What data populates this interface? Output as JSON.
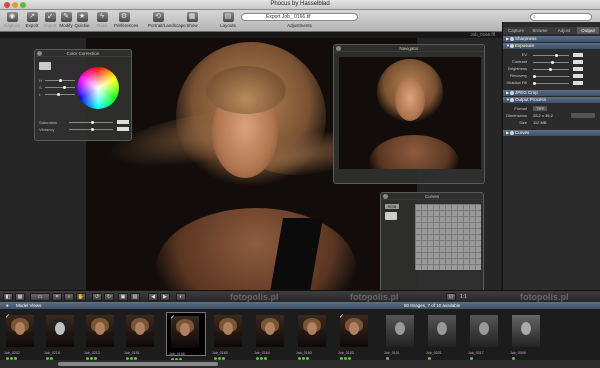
{
  "window": {
    "title": "Phocus by Hasselblad"
  },
  "toolbar": {
    "items": [
      {
        "label": "Capture",
        "enabled": false
      },
      {
        "label": "Export",
        "enabled": true
      },
      {
        "label": "Import",
        "enabled": false
      },
      {
        "label": "Modify",
        "enabled": true
      },
      {
        "label": "Quickie",
        "enabled": true
      },
      {
        "label": "Flash",
        "enabled": false
      },
      {
        "label": "Preferences",
        "enabled": true
      },
      {
        "label": "Portrait/Landscape",
        "enabled": true
      },
      {
        "label": "Show",
        "enabled": true
      },
      {
        "label": "Layouts",
        "enabled": true
      }
    ],
    "adjustments_field": "Export Job_ 0166.tif",
    "adjustments_label": "Adjustments",
    "search_label": "Search"
  },
  "viewer": {
    "status": "Job_0166.fff"
  },
  "color_correction": {
    "title": "Color Correction",
    "rows": [
      "H",
      "S",
      "L"
    ],
    "saturation_label": "Saturation",
    "vibrancy_label": "Vibrancy"
  },
  "navigator": {
    "title": "Navigator"
  },
  "curves": {
    "title": "Curves",
    "channel": "RGB"
  },
  "right_panel": {
    "tabs": [
      "Capture",
      "Browse",
      "Adjust",
      "Output"
    ],
    "active_tab": "Adjust",
    "sections": [
      {
        "title": "Sharpness"
      },
      {
        "title": "Exposure",
        "rows": [
          "EV",
          "Contrast",
          "Brightness",
          "Recovery",
          "Shadow Fill"
        ]
      },
      {
        "title": "JPEG Crop"
      },
      {
        "title": "Output Process",
        "rows": [
          {
            "label": "Format",
            "value": "TIFF"
          },
          {
            "label": "Dimensions",
            "value": "28.2 x 36.2"
          },
          {
            "label": "Size",
            "value": "112 MB"
          }
        ]
      },
      {
        "title": "Curves"
      }
    ]
  },
  "bottom": {
    "zoom_label": "1:1",
    "watermark": "fotopolis.pl"
  },
  "browser": {
    "title": "Model Views",
    "count": "90 Images, 7 of 10 available",
    "thumbs": [
      {
        "name": "Job_0202",
        "checked": true,
        "selected": false
      },
      {
        "name": "Job_0218",
        "checked": false,
        "selected": false
      },
      {
        "name": "Job_0213",
        "checked": false,
        "selected": false
      },
      {
        "name": "Job_0191",
        "checked": false,
        "selected": false
      },
      {
        "name": "Job_0166",
        "checked": true,
        "selected": true
      },
      {
        "name": "Job_0165",
        "checked": false,
        "selected": false
      },
      {
        "name": "Job_0164",
        "checked": false,
        "selected": false
      },
      {
        "name": "Job_0160",
        "checked": false,
        "selected": false
      },
      {
        "name": "Job_0153",
        "checked": true,
        "selected": false
      },
      {
        "name": "Job_0101",
        "checked": false,
        "selected": false
      },
      {
        "name": "Job_0021",
        "checked": false,
        "selected": false
      },
      {
        "name": "Job_0017",
        "checked": false,
        "selected": false
      },
      {
        "name": "Job_0098",
        "checked": false,
        "selected": false
      }
    ]
  },
  "colors": {
    "accent_section": "#4f6179",
    "rating_green": "#5ac040"
  }
}
